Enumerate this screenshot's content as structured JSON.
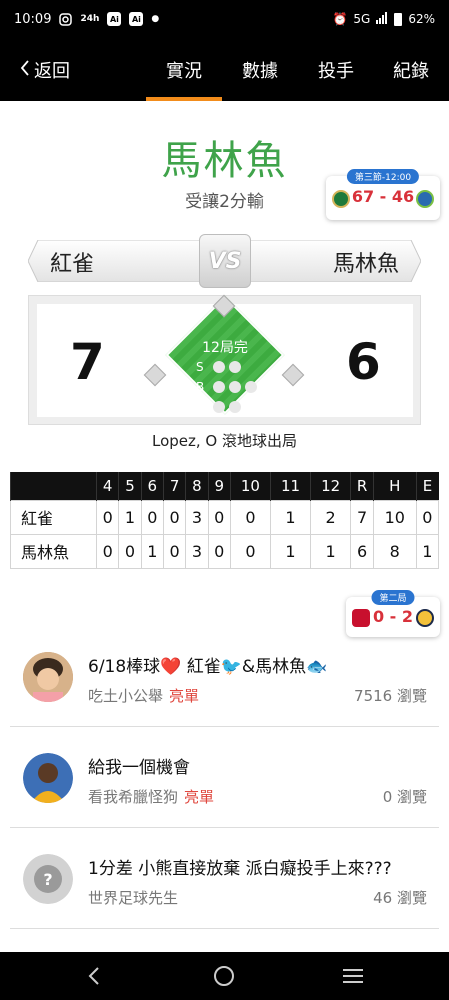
{
  "status_bar": {
    "time": "10:09",
    "right_text": "5G",
    "battery": "62%"
  },
  "nav": {
    "back_label": "返回",
    "tabs": [
      {
        "label": "實況",
        "active": true
      },
      {
        "label": "數據",
        "active": false
      },
      {
        "label": "投手",
        "active": false
      },
      {
        "label": "紀錄",
        "active": false
      }
    ]
  },
  "header": {
    "winner": "馬林魚",
    "subtitle": "受讓2分輸"
  },
  "top_mini_score": {
    "badge": "第三節-12:00",
    "score": "67 - 46"
  },
  "matchup": {
    "away": "紅雀",
    "home": "馬林魚",
    "vs": "VS",
    "away_score": "7",
    "home_score": "6",
    "inning": "12局完",
    "sbo": [
      "S",
      "B",
      "O"
    ],
    "last_play": "Lopez, O 滾地球出局"
  },
  "box_score": {
    "headers": [
      "",
      "4",
      "5",
      "6",
      "7",
      "8",
      "9",
      "10",
      "11",
      "12",
      "R",
      "H",
      "E"
    ],
    "rows": [
      {
        "team": "紅雀",
        "cells": [
          "0",
          "1",
          "0",
          "0",
          "3",
          "0",
          "0",
          "1",
          "2",
          "7",
          "10",
          "0"
        ]
      },
      {
        "team": "馬林魚",
        "cells": [
          "0",
          "0",
          "1",
          "0",
          "3",
          "0",
          "0",
          "1",
          "1",
          "6",
          "8",
          "1"
        ]
      }
    ]
  },
  "second_mini_score": {
    "badge": "第二局",
    "score": "0 - 2"
  },
  "posts": [
    {
      "title": "6/18棒球❤️ 紅雀🐦&馬林魚🐟",
      "author": "吃土小公舉",
      "tag": "亮單",
      "views": "7516 瀏覽",
      "avatar_color": "#c99a6b"
    },
    {
      "title": "給我一個機會",
      "author": "看我希臘怪狗",
      "tag": "亮單",
      "views": "0 瀏覽",
      "avatar_color": "#3d6fb6"
    },
    {
      "title": "1分差 小熊直接放棄 派白癡投手上來???",
      "author": "世界足球先生",
      "tag": "",
      "views": "46 瀏覽",
      "avatar_color": "#cfcfcf"
    }
  ],
  "colors": {
    "accent": "#f28c1b",
    "title_green": "#3fa34a",
    "score_red": "#d8313a",
    "tag_red": "#e0483f",
    "field_green": "#3fb242"
  }
}
